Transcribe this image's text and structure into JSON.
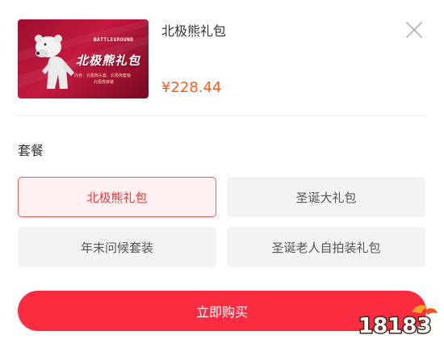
{
  "product": {
    "name": "北极熊礼包",
    "price": "¥228.44",
    "thumbnail": {
      "title_text": "北极熊礼包",
      "game_logo_text": "BATTLEGROUND",
      "caption_line_1": "内含：北极熊头套、北极熊套装",
      "caption_line_2": "北极熊裤装"
    }
  },
  "section_label": "套餐",
  "options": [
    {
      "label": "北极熊礼包",
      "selected": true
    },
    {
      "label": "圣诞大礼包",
      "selected": false
    },
    {
      "label": "年末问候套装",
      "selected": false
    },
    {
      "label": "圣诞老人自拍装礼包",
      "selected": false
    }
  ],
  "buy_button": {
    "label": "立即购买"
  },
  "watermark": {
    "text": "18183"
  },
  "colors": {
    "accent": "#fb2b40",
    "price": "#ff5a1f",
    "selected_border": "#f25a5a",
    "selected_bg": "#fff1f1",
    "option_bg": "#f3f3f3"
  }
}
